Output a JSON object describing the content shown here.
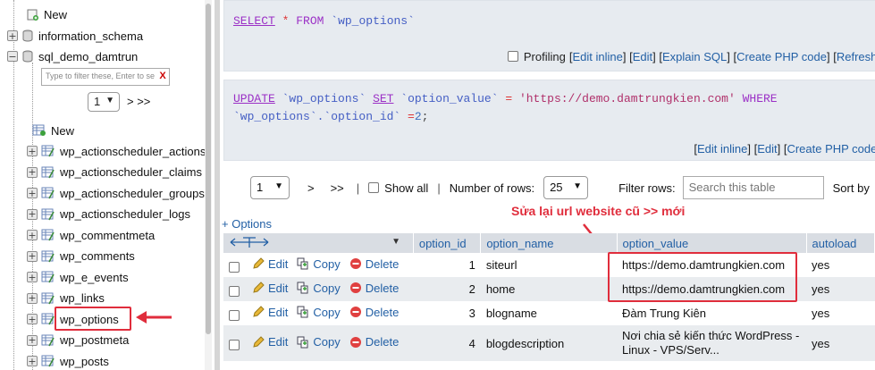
{
  "nav": {
    "new_root": "New",
    "databases": [
      {
        "name": "information_schema",
        "expanded": false
      },
      {
        "name": "sql_demo_damtrun",
        "expanded": true
      }
    ],
    "filter_placeholder": "Type to filter these, Enter to se",
    "filter_clear": "X",
    "page_select": "1",
    "next_label": "> >>",
    "new_table": "New",
    "tables": [
      "wp_actionscheduler_actions",
      "wp_actionscheduler_claims",
      "wp_actionscheduler_groups",
      "wp_actionscheduler_logs",
      "wp_commentmeta",
      "wp_comments",
      "wp_e_events",
      "wp_links",
      "wp_options",
      "wp_postmeta",
      "wp_posts"
    ],
    "highlight_table": "wp_options"
  },
  "query1": {
    "select": "SELECT",
    "star": "*",
    "from": "FROM",
    "table": "`wp_options`",
    "profiling": "Profiling",
    "tools": [
      "[",
      "Edit inline",
      "] [ ",
      "Edit",
      " ] [ ",
      "Explain SQL",
      " ] [ ",
      "Create PHP code",
      " ] [ ",
      "Refresh",
      " ]"
    ]
  },
  "query2": {
    "update": "UPDATE",
    "table": "`wp_options`",
    "set": "SET",
    "col": "`option_value`",
    "eq": "=",
    "value": "'https://demo.damtrungkien.com'",
    "where": "WHERE",
    "qualified": "`wp_options`.`option_id`",
    "eq2": "=",
    "id": "2",
    "semi": ";",
    "tools": [
      "[",
      "Edit inline",
      "] [ ",
      "Edit",
      " ] [ ",
      "Create PHP code",
      " ]"
    ]
  },
  "navbar": {
    "page": "1",
    "next": ">",
    "last": ">>",
    "show_all": "Show all",
    "rows_label": "Number of rows:",
    "rows_value": "25",
    "filter_label": "Filter rows:",
    "filter_placeholder": "Search this table",
    "sort_label": "Sort by"
  },
  "options_link": "+ Options",
  "annotation": "Sửa lại url website cũ >> mới",
  "table": {
    "columns": [
      "option_id",
      "option_name",
      "option_value",
      "autoload"
    ],
    "actions": {
      "edit": "Edit",
      "copy": "Copy",
      "delete": "Delete"
    },
    "rows": [
      {
        "id": "1",
        "name": "siteurl",
        "value": "https://demo.damtrungkien.com",
        "autoload": "yes"
      },
      {
        "id": "2",
        "name": "home",
        "value": "https://demo.damtrungkien.com",
        "autoload": "yes"
      },
      {
        "id": "3",
        "name": "blogname",
        "value": "Đàm Trung Kiên",
        "autoload": "yes"
      },
      {
        "id": "4",
        "name": "blogdescription",
        "value": "Nơi chia sẻ kiến thức WordPress - Linux - VPS/Serv...",
        "autoload": "yes"
      }
    ]
  },
  "colors": {
    "accent_red": "#e02d3c",
    "link_blue": "#2360a5",
    "sql_bg": "#e7ebf0"
  }
}
